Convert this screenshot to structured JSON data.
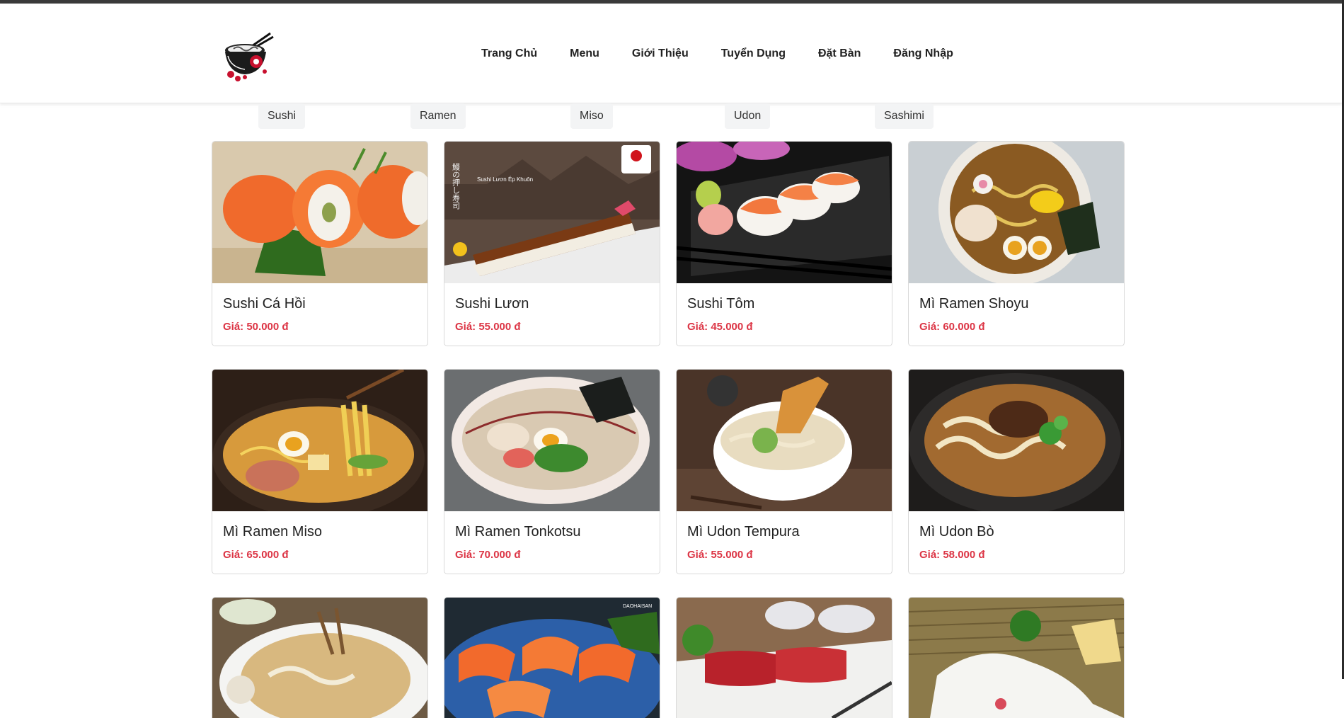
{
  "brand": {
    "logo_icon": "ramen-bowl-logo-icon"
  },
  "nav": {
    "items": [
      {
        "label": "Trang Chủ"
      },
      {
        "label": "Menu"
      },
      {
        "label": "Giới Thiệu"
      },
      {
        "label": "Tuyển Dụng"
      },
      {
        "label": "Đặt Bàn"
      },
      {
        "label": "Đăng Nhập"
      }
    ]
  },
  "categories": [
    {
      "label": "Sushi"
    },
    {
      "label": "Ramen"
    },
    {
      "label": "Miso"
    },
    {
      "label": "Udon"
    },
    {
      "label": "Sashimi"
    }
  ],
  "products": [
    {
      "name": "Sushi Cá Hồi",
      "price": "Giá: 50.000 đ"
    },
    {
      "name": "Sushi Lươn",
      "price": "Giá: 55.000 đ"
    },
    {
      "name": "Sushi Tôm",
      "price": "Giá: 45.000 đ"
    },
    {
      "name": "Mì Ramen Shoyu",
      "price": "Giá: 60.000 đ"
    },
    {
      "name": "Mì Ramen Miso",
      "price": "Giá: 65.000 đ"
    },
    {
      "name": "Mì Ramen Tonkotsu",
      "price": "Giá: 70.000 đ"
    },
    {
      "name": "Mì Udon Tempura",
      "price": "Giá: 55.000 đ"
    },
    {
      "name": "Mì Udon Bò",
      "price": "Giá: 58.000 đ"
    }
  ],
  "image_texts": {
    "unagi_caption": "Sushi Lươn Ép Khuôn",
    "unagi_vertical": "鰻の押し寿司",
    "dao_brand": "DAOHAISAN"
  },
  "colors": {
    "price_red": "#dc3545",
    "chip_bg": "#f3f4f5"
  }
}
